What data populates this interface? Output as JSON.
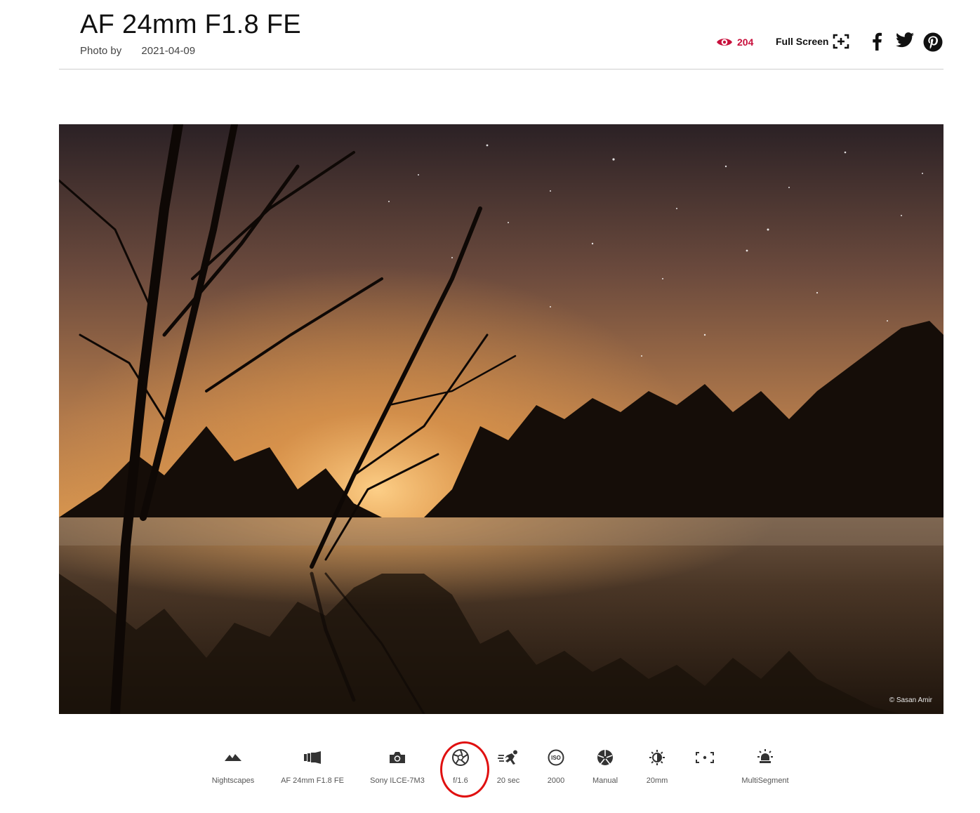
{
  "header": {
    "title": "AF 24mm F1.8 FE",
    "photo_by_label": "Photo by",
    "date": "2021-04-09",
    "views": "204",
    "fullscreen_label": "Full Screen"
  },
  "icons": {
    "views": "eye-icon",
    "fullscreen": "fullscreen-icon",
    "facebook": "facebook-icon",
    "twitter": "twitter-icon",
    "pinterest": "pinterest-icon"
  },
  "photo": {
    "credit": "© Sasan Amir"
  },
  "exif": [
    {
      "icon": "mountains-icon",
      "label": "Nightscapes"
    },
    {
      "icon": "lens-icon",
      "label": "AF 24mm F1.8 FE"
    },
    {
      "icon": "camera-icon",
      "label": "Sony ILCE-7M3"
    },
    {
      "icon": "aperture-icon",
      "label": "f/1.6"
    },
    {
      "icon": "shutter-speed-icon",
      "label": "20 sec"
    },
    {
      "icon": "iso-icon",
      "label": "2000"
    },
    {
      "icon": "exposure-mode-icon",
      "label": "Manual"
    },
    {
      "icon": "focal-length-icon",
      "label": "20mm"
    },
    {
      "icon": "focus-point-icon",
      "label": ""
    },
    {
      "icon": "metering-icon",
      "label": "MultiSegment"
    }
  ],
  "colors": {
    "accent": "#c8103c",
    "annotation": "#e01010"
  }
}
